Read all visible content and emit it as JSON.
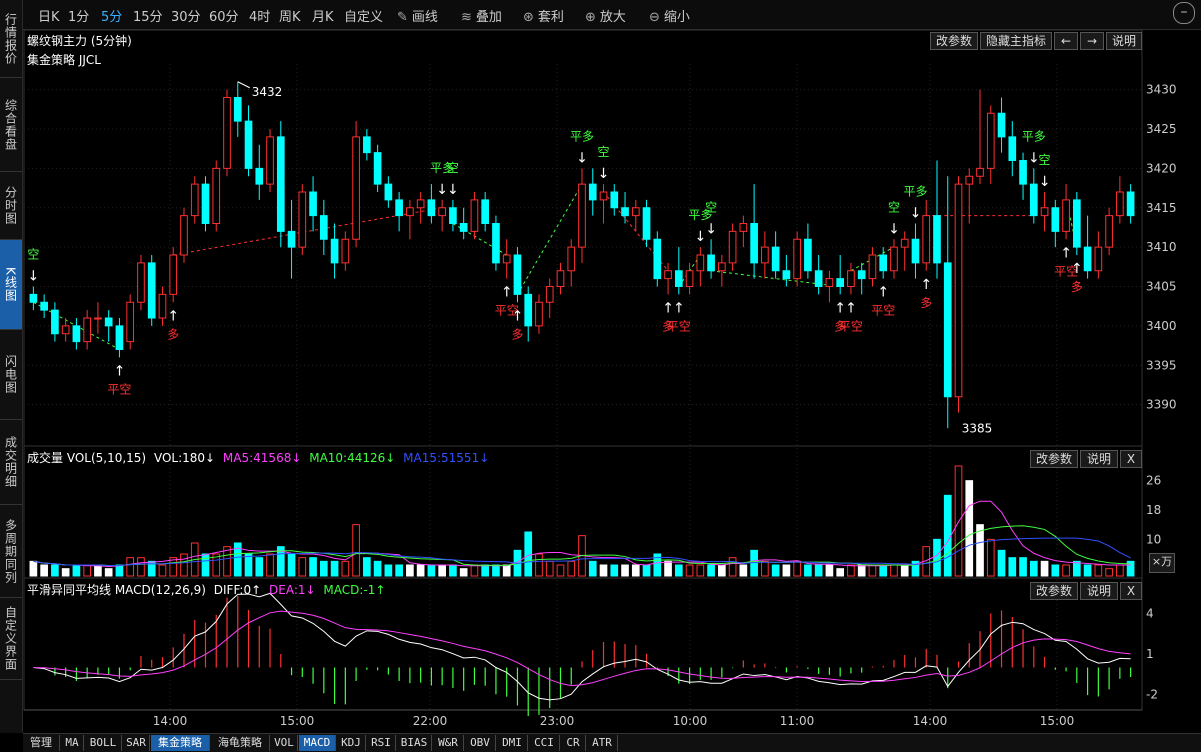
{
  "left_nav": [
    "行情报价",
    "综合看盘",
    "分时图",
    "K线图",
    "闪电图",
    "成交明细",
    "多周期同列",
    "自定义界面"
  ],
  "toolbar": {
    "periods": [
      "日K",
      "1分",
      "5分",
      "15分",
      "30分",
      "60分",
      "4时",
      "周K",
      "月K",
      "自定义"
    ],
    "active_period": "5分",
    "tools": [
      {
        "icon": "pencil-icon",
        "glyph": "✎",
        "label": "画线"
      },
      {
        "icon": "layers-icon",
        "glyph": "≋",
        "label": "叠加"
      },
      {
        "icon": "arbitrage-icon",
        "glyph": "⊛",
        "label": "套利"
      },
      {
        "icon": "zoom-in-icon",
        "glyph": "⊕",
        "label": "放大"
      },
      {
        "icon": "zoom-out-icon",
        "glyph": "⊖",
        "label": "缩小"
      }
    ],
    "minimize": "–"
  },
  "main_panel": {
    "title": "螺纹钢主力 (5分钟)",
    "strategy": "集金策略 JJCL",
    "buttons": [
      "改参数",
      "隐藏主指标",
      "←",
      "→",
      "说明"
    ],
    "high_label": "3432",
    "low_label": "3385"
  },
  "vol_panel": {
    "title": "成交量 VOL(5,10,15)",
    "vol": "VOL:180↓",
    "ma5": "MA5:41568↓",
    "ma10": "MA10:44126↓",
    "ma15": "MA15:51551↓",
    "buttons": [
      "改参数",
      "说明",
      "X"
    ],
    "unit": "×万"
  },
  "macd_panel": {
    "title": "平滑异同平均线 MACD(12,26,9)",
    "diff": "DIFF:0↑",
    "dea": "DEA:1↓",
    "macd": "MACD:-1↑",
    "buttons": [
      "改参数",
      "说明",
      "X"
    ]
  },
  "bottom_tabs": [
    "管理",
    "MA",
    "BOLL",
    "SAR",
    "集金策略",
    "海龟策略",
    "VOL",
    "MACD",
    "KDJ",
    "RSI",
    "BIAS",
    "W&R",
    "OBV",
    "DMI",
    "CCI",
    "CR",
    "ATR"
  ],
  "bottom_active": [
    "集金策略",
    "MACD"
  ],
  "colors": {
    "up": "#ff3030",
    "down": "#00ffff",
    "ma5": "#ff40ff",
    "ma10": "#40ff40",
    "ma15": "#3050ff",
    "signal_buy": "#ff3030",
    "signal_sell": "#40ff40",
    "accent": "#1a5fa8"
  },
  "chart_data": [
    {
      "type": "candlestick",
      "title": "螺纹钢主力 (5分钟)",
      "y_ticks": [
        3390,
        3395,
        3400,
        3405,
        3410,
        3415,
        3420,
        3425,
        3430
      ],
      "ylim": [
        3385,
        3433
      ],
      "x_ticks": [
        "14:00",
        "15:00",
        "22:00",
        "23:00",
        "10:00",
        "11:00",
        "14:00",
        "15:00"
      ],
      "ohlc": [
        [
          3404,
          3405,
          3402,
          3403
        ],
        [
          3403,
          3404,
          3401,
          3402
        ],
        [
          3402,
          3403,
          3398,
          3399
        ],
        [
          3399,
          3401,
          3398,
          3400
        ],
        [
          3400,
          3401,
          3397,
          3398
        ],
        [
          3398,
          3402,
          3397,
          3401
        ],
        [
          3401,
          3403,
          3399,
          3401
        ],
        [
          3401,
          3402,
          3398,
          3400
        ],
        [
          3400,
          3401,
          3396,
          3397
        ],
        [
          3398,
          3404,
          3397,
          3403
        ],
        [
          3403,
          3409,
          3402,
          3408
        ],
        [
          3408,
          3409,
          3400,
          3401
        ],
        [
          3401,
          3405,
          3400,
          3404
        ],
        [
          3404,
          3410,
          3403,
          3409
        ],
        [
          3409,
          3415,
          3408,
          3414
        ],
        [
          3414,
          3419,
          3413,
          3418
        ],
        [
          3418,
          3419,
          3412,
          3413
        ],
        [
          3413,
          3421,
          3412,
          3420
        ],
        [
          3420,
          3430,
          3419,
          3429
        ],
        [
          3429,
          3431,
          3424,
          3426
        ],
        [
          3426,
          3428,
          3419,
          3420
        ],
        [
          3420,
          3423,
          3416,
          3418
        ],
        [
          3418,
          3425,
          3417,
          3424
        ],
        [
          3424,
          3426,
          3410,
          3412
        ],
        [
          3412,
          3416,
          3406,
          3410
        ],
        [
          3410,
          3418,
          3409,
          3417
        ],
        [
          3417,
          3419,
          3412,
          3414
        ],
        [
          3414,
          3416,
          3409,
          3411
        ],
        [
          3411,
          3413,
          3406,
          3408
        ],
        [
          3408,
          3412,
          3407,
          3411
        ],
        [
          3411,
          3426,
          3410,
          3424
        ],
        [
          3424,
          3425,
          3421,
          3422
        ],
        [
          3422,
          3423,
          3417,
          3418
        ],
        [
          3418,
          3419,
          3415,
          3416
        ],
        [
          3416,
          3417,
          3412,
          3414
        ],
        [
          3414,
          3416,
          3411,
          3415
        ],
        [
          3415,
          3417,
          3413,
          3416
        ],
        [
          3416,
          3418,
          3413,
          3414
        ],
        [
          3414,
          3416,
          3412,
          3415
        ],
        [
          3415,
          3416,
          3412,
          3413
        ],
        [
          3413,
          3415,
          3411,
          3412
        ],
        [
          3412,
          3417,
          3411,
          3416
        ],
        [
          3416,
          3417,
          3412,
          3413
        ],
        [
          3413,
          3414,
          3407,
          3408
        ],
        [
          3408,
          3411,
          3406,
          3409
        ],
        [
          3409,
          3410,
          3403,
          3404
        ],
        [
          3404,
          3405,
          3398,
          3400
        ],
        [
          3400,
          3404,
          3399,
          3403
        ],
        [
          3403,
          3406,
          3401,
          3405
        ],
        [
          3405,
          3408,
          3404,
          3407
        ],
        [
          3407,
          3411,
          3405,
          3410
        ],
        [
          3410,
          3420,
          3408,
          3418
        ],
        [
          3418,
          3420,
          3414,
          3416
        ],
        [
          3416,
          3418,
          3413,
          3417
        ],
        [
          3417,
          3418,
          3414,
          3415
        ],
        [
          3415,
          3417,
          3413,
          3414
        ],
        [
          3414,
          3416,
          3412,
          3415
        ],
        [
          3415,
          3416,
          3410,
          3411
        ],
        [
          3411,
          3412,
          3405,
          3406
        ],
        [
          3406,
          3408,
          3404,
          3407
        ],
        [
          3407,
          3410,
          3404,
          3405
        ],
        [
          3405,
          3408,
          3404,
          3407
        ],
        [
          3407,
          3410,
          3405,
          3409
        ],
        [
          3409,
          3411,
          3406,
          3407
        ],
        [
          3407,
          3409,
          3405,
          3408
        ],
        [
          3408,
          3413,
          3407,
          3412
        ],
        [
          3412,
          3414,
          3410,
          3413
        ],
        [
          3413,
          3418,
          3406,
          3408
        ],
        [
          3408,
          3412,
          3406,
          3410
        ],
        [
          3410,
          3412,
          3406,
          3407
        ],
        [
          3407,
          3409,
          3405,
          3406
        ],
        [
          3406,
          3412,
          3405,
          3411
        ],
        [
          3411,
          3413,
          3406,
          3407
        ],
        [
          3407,
          3409,
          3404,
          3405
        ],
        [
          3405,
          3407,
          3403,
          3406
        ],
        [
          3406,
          3409,
          3404,
          3405
        ],
        [
          3405,
          3408,
          3404,
          3407
        ],
        [
          3407,
          3408,
          3404,
          3406
        ],
        [
          3406,
          3410,
          3405,
          3409
        ],
        [
          3409,
          3410,
          3406,
          3407
        ],
        [
          3407,
          3411,
          3406,
          3410
        ],
        [
          3410,
          3412,
          3407,
          3411
        ],
        [
          3411,
          3413,
          3406,
          3408
        ],
        [
          3408,
          3416,
          3407,
          3414
        ],
        [
          3414,
          3421,
          3406,
          3408
        ],
        [
          3408,
          3419,
          3387,
          3391
        ],
        [
          3391,
          3419,
          3389,
          3418
        ],
        [
          3418,
          3420,
          3413,
          3419
        ],
        [
          3419,
          3430,
          3418,
          3420
        ],
        [
          3420,
          3428,
          3418,
          3427
        ],
        [
          3427,
          3429,
          3422,
          3424
        ],
        [
          3424,
          3426,
          3419,
          3421
        ],
        [
          3421,
          3422,
          3416,
          3418
        ],
        [
          3418,
          3420,
          3413,
          3414
        ],
        [
          3414,
          3417,
          3412,
          3415
        ],
        [
          3415,
          3416,
          3410,
          3412
        ],
        [
          3412,
          3418,
          3411,
          3416
        ],
        [
          3416,
          3417,
          3409,
          3410
        ],
        [
          3410,
          3414,
          3406,
          3407
        ],
        [
          3407,
          3412,
          3406,
          3410
        ],
        [
          3410,
          3415,
          3409,
          3414
        ],
        [
          3414,
          3419,
          3413,
          3417
        ],
        [
          3417,
          3418,
          3413,
          3414
        ]
      ],
      "signals": [
        {
          "i": 0,
          "label": "空",
          "dir": "sell"
        },
        {
          "i": 8,
          "label": "平空",
          "dir": "buy"
        },
        {
          "i": 13,
          "label": "多",
          "dir": "buy"
        },
        {
          "i": 38,
          "label": "平多",
          "dir": "sell"
        },
        {
          "i": 39,
          "label": "空",
          "dir": "sell"
        },
        {
          "i": 44,
          "label": "平空",
          "dir": "buy"
        },
        {
          "i": 45,
          "label": "多",
          "dir": "buy"
        },
        {
          "i": 51,
          "label": "平多",
          "dir": "sell"
        },
        {
          "i": 53,
          "label": "空",
          "dir": "sell"
        },
        {
          "i": 59,
          "label": "多",
          "dir": "buy"
        },
        {
          "i": 60,
          "label": "平空",
          "dir": "buy"
        },
        {
          "i": 62,
          "label": "平多",
          "dir": "sell"
        },
        {
          "i": 63,
          "label": "空",
          "dir": "sell"
        },
        {
          "i": 75,
          "label": "多",
          "dir": "buy"
        },
        {
          "i": 76,
          "label": "平空",
          "dir": "buy"
        },
        {
          "i": 79,
          "label": "平空",
          "dir": "buy"
        },
        {
          "i": 80,
          "label": "空",
          "dir": "sell"
        },
        {
          "i": 82,
          "label": "平多",
          "dir": "sell"
        },
        {
          "i": 83,
          "label": "多",
          "dir": "buy"
        },
        {
          "i": 93,
          "label": "平多",
          "dir": "sell"
        },
        {
          "i": 94,
          "label": "空",
          "dir": "sell"
        },
        {
          "i": 96,
          "label": "平空",
          "dir": "buy"
        },
        {
          "i": 97,
          "label": "多",
          "dir": "buy"
        }
      ]
    },
    {
      "type": "bar",
      "title": "成交量 VOL(5,10,15)",
      "y_ticks": [
        10,
        18,
        26
      ],
      "ylim": [
        0,
        30
      ],
      "values": [
        4,
        3,
        3,
        2,
        3,
        3,
        3,
        2,
        3,
        5,
        5,
        4,
        3,
        5,
        6,
        9,
        6,
        6,
        8,
        9,
        6,
        5,
        6,
        8,
        6,
        5,
        5,
        4,
        4,
        4,
        14,
        5,
        4,
        3,
        3,
        3,
        3,
        3,
        3,
        3,
        2,
        3,
        3,
        3,
        3,
        7,
        12,
        6,
        4,
        3,
        4,
        11,
        4,
        3,
        3,
        3,
        3,
        3,
        6,
        4,
        3,
        3,
        3,
        3,
        3,
        5,
        3,
        7,
        4,
        3,
        3,
        4,
        3,
        3,
        3,
        2,
        3,
        3,
        3,
        3,
        3,
        3,
        4,
        8,
        10,
        22,
        30,
        26,
        14,
        10,
        7,
        5,
        5,
        4,
        4,
        3,
        3,
        4,
        3,
        3,
        2,
        3,
        4
      ]
    },
    {
      "type": "line",
      "title": "平滑异同平均线 MACD(12,26,9)",
      "y_ticks": [
        -2,
        1,
        4
      ],
      "ylim": [
        -3,
        5
      ]
    }
  ]
}
